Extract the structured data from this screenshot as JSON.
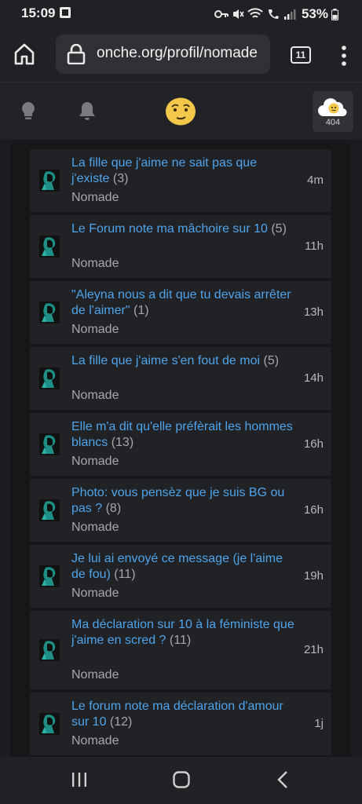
{
  "status_bar": {
    "time": "15:09",
    "battery": "53%"
  },
  "browser": {
    "url": "onche.org/profil/nomade",
    "tab_count": "11"
  },
  "site_header": {
    "notification_count": "404"
  },
  "topics": [
    {
      "title": "La fille que j'aime ne sait pas que j'existe",
      "count": "(3)",
      "author": "Nomade",
      "time": "4m"
    },
    {
      "title": "Le Forum note ma mâchoire sur 10",
      "count": "(5)",
      "author": "Nomade",
      "time": "11h"
    },
    {
      "title": "\"Aleyna nous a dit que tu devais arrêter de l'aimer\"",
      "count": "(1)",
      "author": "Nomade",
      "time": "13h"
    },
    {
      "title": "La fille que j'aime s'en fout de moi",
      "count": "(5)",
      "author": "Nomade",
      "time": "14h"
    },
    {
      "title": "Elle m'a dit qu'elle préfèrait les hommes blancs",
      "count": "(13)",
      "author": "Nomade",
      "time": "16h"
    },
    {
      "title": "Photo: vous pensèz que je suis BG ou pas ?",
      "count": "(8)",
      "author": "Nomade",
      "time": "16h"
    },
    {
      "title": "Je lui ai envoyé ce message (je l'aime de fou)",
      "count": "(11)",
      "author": "Nomade",
      "time": "19h"
    },
    {
      "title": "Ma déclaration sur 10 à la féministe que j'aime en scred ?",
      "count": "(11)",
      "author": "Nomade",
      "time": "21h"
    },
    {
      "title": "Le forum note ma déclaration d'amour sur 10",
      "count": "(12)",
      "author": "Nomade",
      "time": "1j"
    }
  ]
}
